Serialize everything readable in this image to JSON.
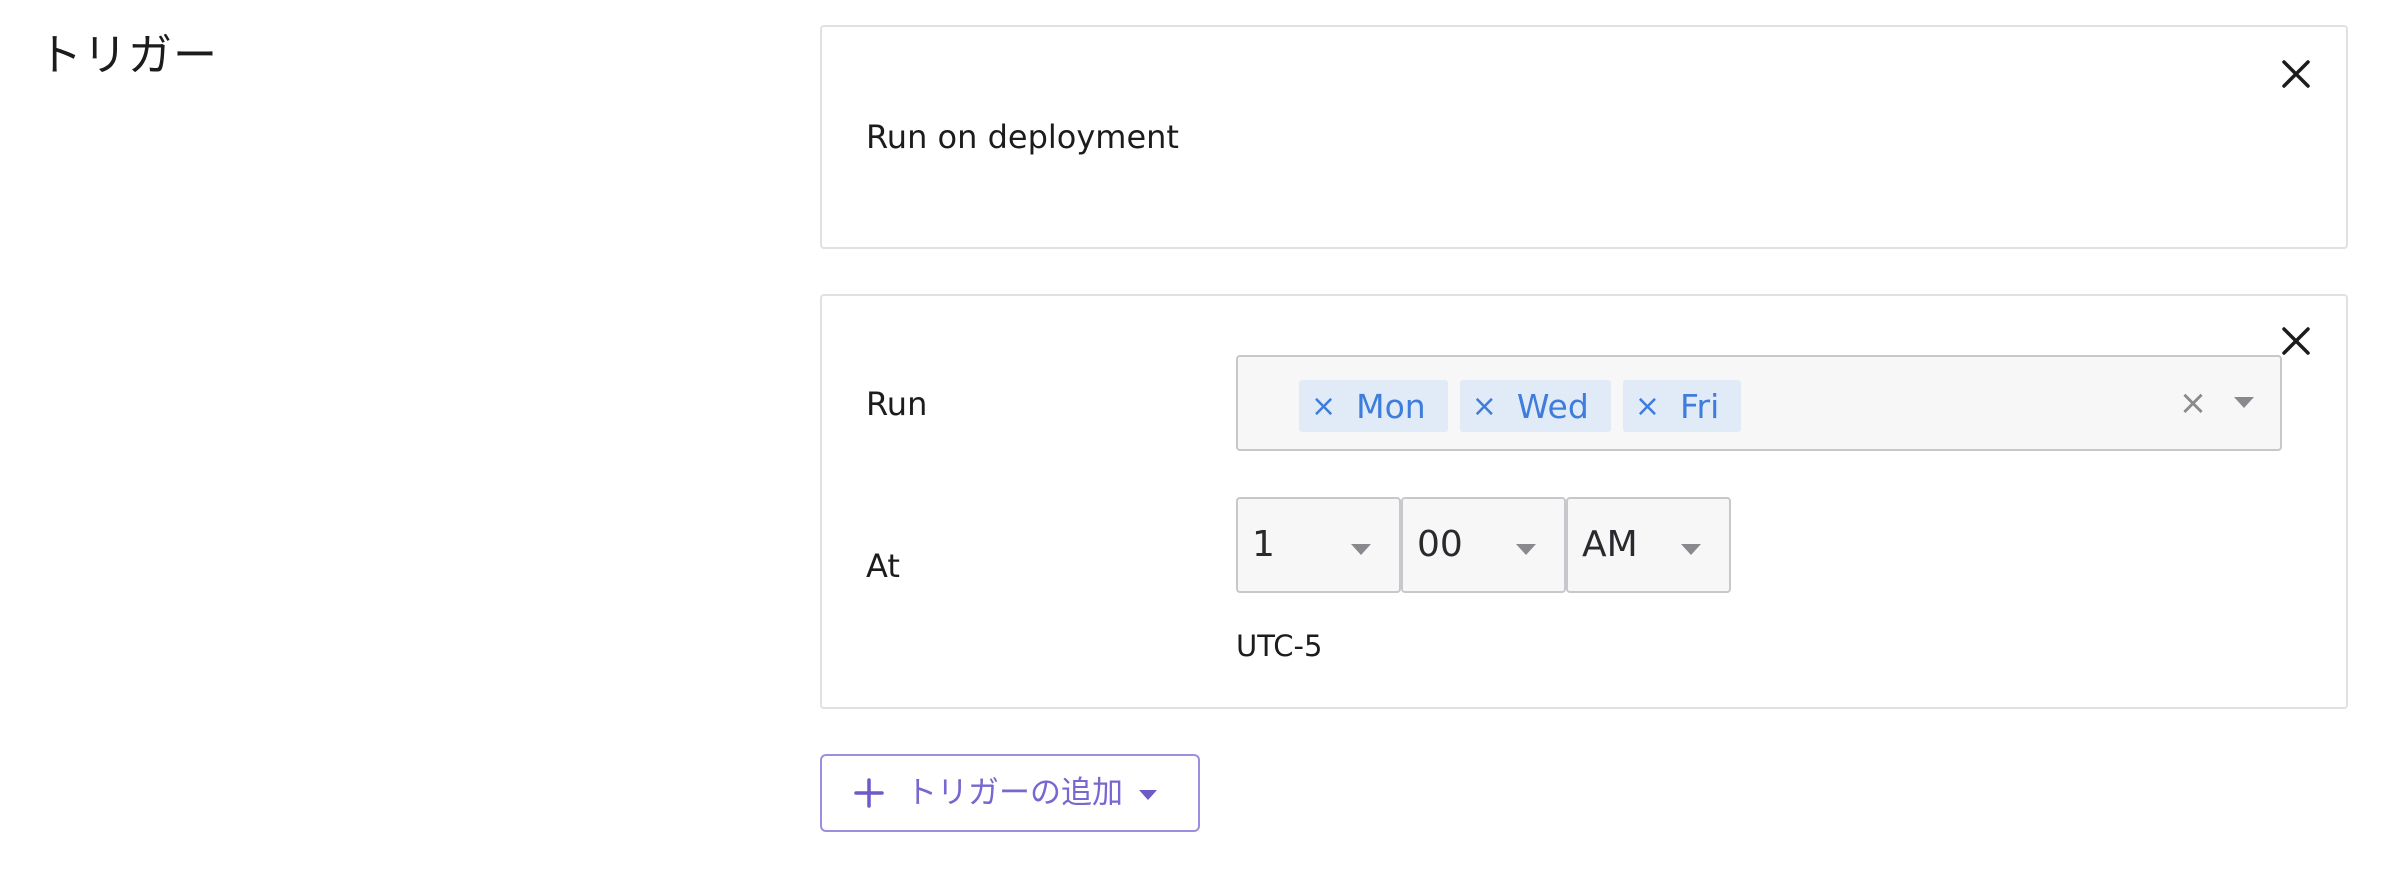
{
  "section": {
    "title": "トリガー"
  },
  "triggers": [
    {
      "label": "Run on deployment",
      "close_icon": "close-icon"
    },
    {
      "run_label": "Run",
      "days": [
        {
          "label": "Mon",
          "remove": "×"
        },
        {
          "label": "Wed",
          "remove": "×"
        },
        {
          "label": "Fri",
          "remove": "×"
        }
      ],
      "clear_all": "×",
      "at_label": "At",
      "hour": "1",
      "minute": "00",
      "ampm": "AM",
      "timezone": "UTC-5",
      "close_icon": "close-icon"
    }
  ],
  "add_trigger": {
    "label": "トリガーの追加",
    "icon": "plus-icon"
  },
  "colors": {
    "chip_bg": "#e1ebf8",
    "chip_text": "#3f7ddc",
    "accent": "#7a66d0",
    "border": "#e1e1e3"
  }
}
